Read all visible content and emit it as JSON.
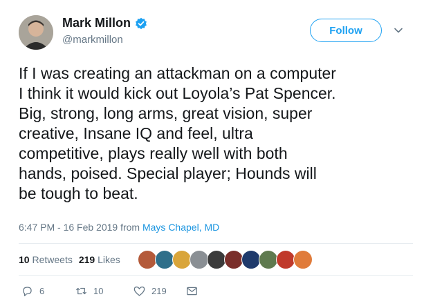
{
  "author": {
    "name": "Mark Millon",
    "handle": "@markmillon",
    "verified": true,
    "avatar_icon": "user-avatar"
  },
  "follow_label": "Follow",
  "tweet": {
    "text": "If I was creating an attackman on a computer\nI think it would kick out Loyola’s Pat Spencer.\nBig, strong, long arms, great vision, super\ncreative, Insane IQ and feel, ultra\ncompetitive, plays really well with both\nhands, poised. Special player; Hounds will\nbe tough to beat."
  },
  "meta": {
    "time": "6:47 PM - 16 Feb 2019 from ",
    "location": "Mays Chapel, MD"
  },
  "stats": {
    "retweets_count": "10",
    "retweets_label": "Retweets",
    "likes_count": "219",
    "likes_label": "Likes"
  },
  "likers": [
    {
      "name": "liker-1",
      "color": "#b45a3a"
    },
    {
      "name": "liker-2",
      "color": "#2f6f8a"
    },
    {
      "name": "liker-3",
      "color": "#d9a53a"
    },
    {
      "name": "liker-4",
      "color": "#8a8f94"
    },
    {
      "name": "liker-5",
      "color": "#3b3b3b"
    },
    {
      "name": "liker-6",
      "color": "#7a2e2a"
    },
    {
      "name": "liker-7",
      "color": "#1f3a6b"
    },
    {
      "name": "liker-8",
      "color": "#5f7a4f"
    },
    {
      "name": "liker-9",
      "color": "#c0392b"
    },
    {
      "name": "liker-10",
      "color": "#e07b3a"
    }
  ],
  "actions": {
    "reply_count": "6",
    "retweet_count": "10",
    "like_count": "219"
  },
  "colors": {
    "accent": "#1da1f2",
    "muted": "#657786"
  }
}
